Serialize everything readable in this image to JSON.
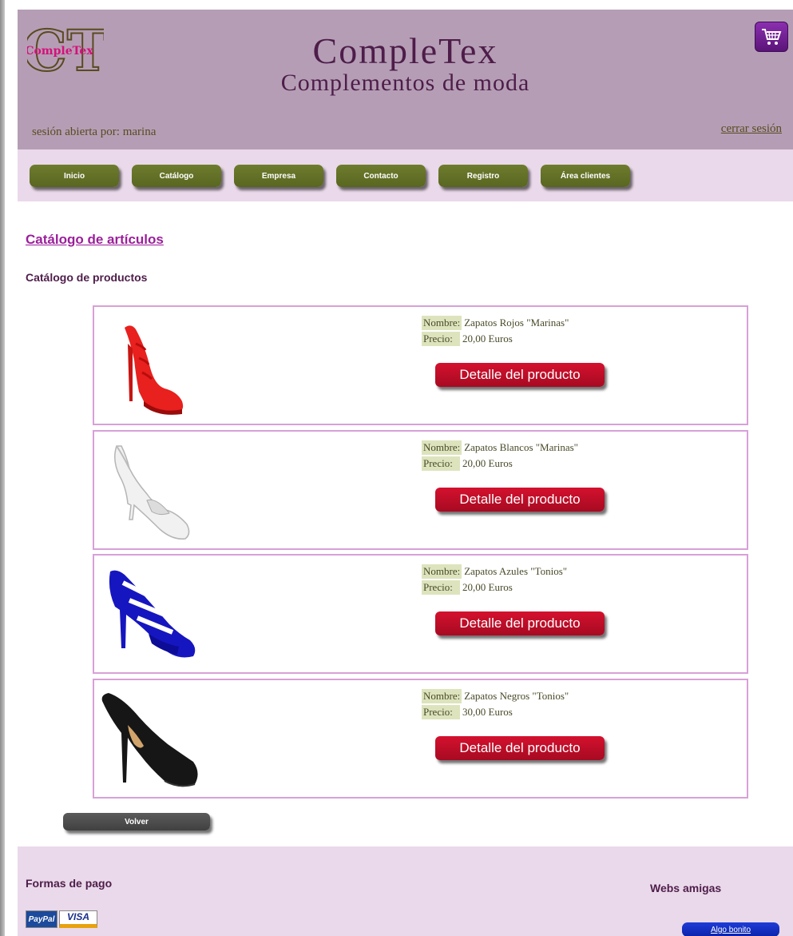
{
  "header": {
    "logo_text": "CompleTex",
    "logo_monogram": "CT",
    "title": "CompleTex",
    "subtitle": "Complementos de moda",
    "session_text": "sesión abierta por: marina",
    "logout_label": "cerrar sesión",
    "cart_icon": "shopping-cart-icon"
  },
  "nav": {
    "items": [
      {
        "label": "Inicio"
      },
      {
        "label": "Catálogo"
      },
      {
        "label": "Empresa"
      },
      {
        "label": "Contacto"
      },
      {
        "label": "Registro"
      },
      {
        "label": "Área clientes"
      }
    ]
  },
  "main": {
    "title": "Catálogo de artículos",
    "subtitle": "Catálogo de productos",
    "name_label": "Nombre:",
    "price_label": "Precio:",
    "detail_label": "Detalle del producto",
    "products": [
      {
        "name": "Zapatos Rojos \"Marinas\"",
        "price": "20,00 Euros",
        "image": "red-heel-shoe"
      },
      {
        "name": "Zapatos Blancos \"Marinas\"",
        "price": "20,00 Euros",
        "image": "white-slingback-shoe"
      },
      {
        "name": "Zapatos Azules \"Tonios\"",
        "price": "20,00 Euros",
        "image": "blue-strappy-shoe"
      },
      {
        "name": "Zapatos Negros \"Tonios\"",
        "price": "30,00 Euros",
        "image": "black-pump-shoe"
      }
    ],
    "back_label": "Volver"
  },
  "footer": {
    "payment_title": "Formas de pago",
    "paypal_label": "PayPal",
    "visa_label": "VISA",
    "friends_title": "Webs amigas",
    "friend_link": "Algo bonito"
  },
  "colors": {
    "header_bg": "#b59eb5",
    "nav_bg": "#ead9ea",
    "nav_button": "#6e7c2e",
    "detail_button": "#c40f2a",
    "title_purple": "#4e1d4a",
    "product_border": "#d8a0d8"
  }
}
